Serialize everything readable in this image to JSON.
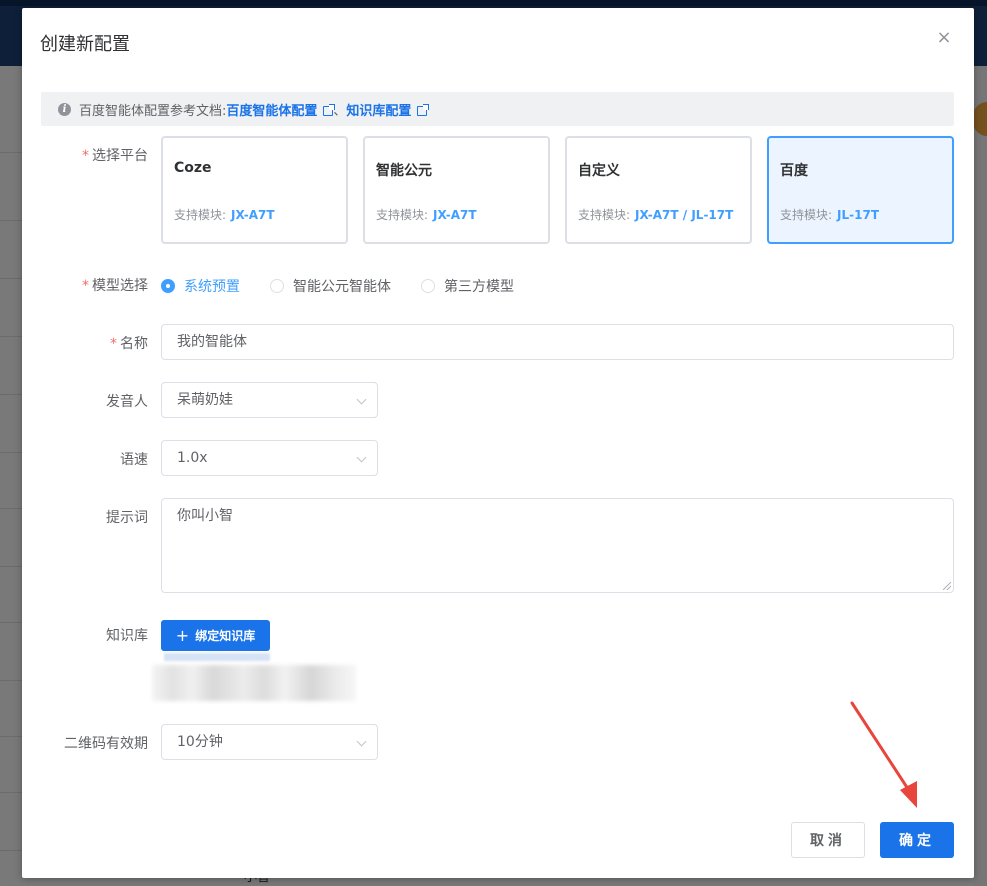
{
  "dialog": {
    "title": "创建新配置",
    "close_symbol": "×"
  },
  "info": {
    "prefix": "百度智能体配置参考文档:",
    "link1": "百度智能体配置",
    "separator": "、",
    "link2": "知识库配置"
  },
  "platform": {
    "label": "选择平台",
    "cards": [
      {
        "name": "Coze",
        "modules_label": "支持模块:",
        "modules": "JX-A7T"
      },
      {
        "name": "智能公元",
        "modules_label": "支持模块:",
        "modules": "JX-A7T"
      },
      {
        "name": "自定义",
        "modules_label": "支持模块:",
        "modules": "JX-A7T / JL-17T"
      },
      {
        "name": "百度",
        "modules_label": "支持模块:",
        "modules": "JL-17T"
      }
    ]
  },
  "model": {
    "label": "模型选择",
    "options": [
      "系统预置",
      "智能公元智能体",
      "第三方模型"
    ],
    "selected": "系统预置"
  },
  "name": {
    "label": "名称",
    "value": "我的智能体"
  },
  "speaker": {
    "label": "发音人",
    "value": "呆萌奶娃"
  },
  "speed": {
    "label": "语速",
    "value": "1.0x"
  },
  "prompt": {
    "label": "提示词",
    "value": "你叫小智"
  },
  "knowledge": {
    "label": "知识库",
    "bind_button": "绑定知识库"
  },
  "qrcode": {
    "label": "二维码有效期",
    "value": "10分钟"
  },
  "footer": {
    "cancel": "取消",
    "confirm": "确定"
  },
  "background": {
    "text": "小智"
  },
  "colors": {
    "primary": "#1a73e8",
    "selected_card_border": "#409eff",
    "required": "#f56c6c",
    "arrow": "#e8453c"
  }
}
